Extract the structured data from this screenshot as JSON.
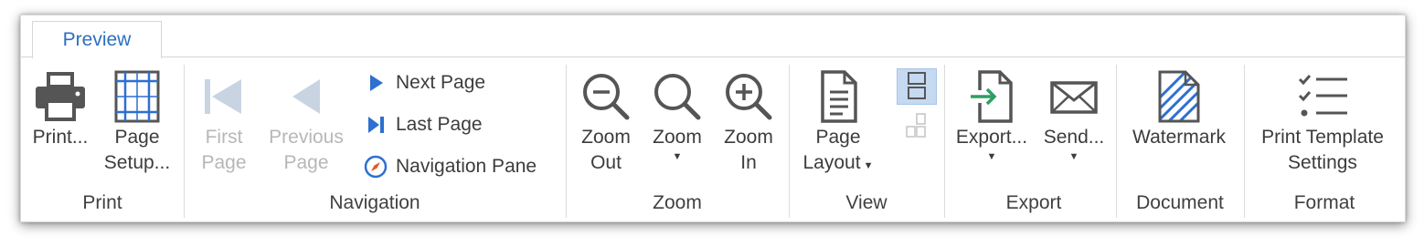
{
  "tabs": [
    {
      "label": "Preview"
    }
  ],
  "groups": {
    "print": {
      "label": "Print",
      "buttons": [
        {
          "label1": "Print...",
          "label2": "",
          "icon": "printer-icon"
        },
        {
          "label1": "Page",
          "label2": "Setup...",
          "icon": "page-setup-icon"
        }
      ]
    },
    "navigation": {
      "label": "Navigation",
      "first_page": {
        "label1": "First",
        "label2": "Page",
        "icon": "first-page-icon",
        "enabled": false
      },
      "previous_page": {
        "label1": "Previous",
        "label2": "Page",
        "icon": "previous-page-icon",
        "enabled": false
      },
      "next_page": {
        "label": "Next Page",
        "icon": "next-page-icon"
      },
      "last_page": {
        "label": "Last Page",
        "icon": "last-page-icon"
      },
      "navigation_pane": {
        "label": "Navigation Pane",
        "icon": "compass-icon"
      }
    },
    "zoom": {
      "label": "Zoom",
      "zoom_out": {
        "label1": "Zoom",
        "label2": "Out",
        "icon": "zoom-out-icon"
      },
      "zoom": {
        "label1": "Zoom",
        "icon": "magnifier-icon",
        "has_dropdown": true
      },
      "zoom_in": {
        "label1": "Zoom",
        "label2": "In",
        "icon": "zoom-in-icon"
      }
    },
    "view": {
      "label": "View",
      "page_layout": {
        "label1": "Page",
        "label2": "Layout",
        "icon": "page-layout-icon",
        "has_dropdown": true
      },
      "single_page": {
        "icon": "single-page-view-icon",
        "selected": true
      },
      "multi_page": {
        "icon": "multi-page-view-icon",
        "enabled": false
      }
    },
    "export": {
      "label": "Export",
      "export": {
        "label1": "Export...",
        "icon": "export-icon",
        "has_dropdown": true
      },
      "send": {
        "label1": "Send...",
        "icon": "envelope-icon",
        "has_dropdown": true
      }
    },
    "document": {
      "label": "Document",
      "watermark": {
        "label1": "Watermark",
        "icon": "watermark-icon"
      }
    },
    "format": {
      "label": "Format",
      "print_template": {
        "label1": "Print Template",
        "label2": "Settings",
        "icon": "checklist-icon"
      }
    }
  },
  "colors": {
    "accent": "#2b6fbf",
    "icon": "#555555",
    "disabled": "#b7b7b7",
    "blue_icon": "#2e6fd0",
    "export_green": "#2f9e63",
    "selected_bg": "#c5d9f1"
  }
}
